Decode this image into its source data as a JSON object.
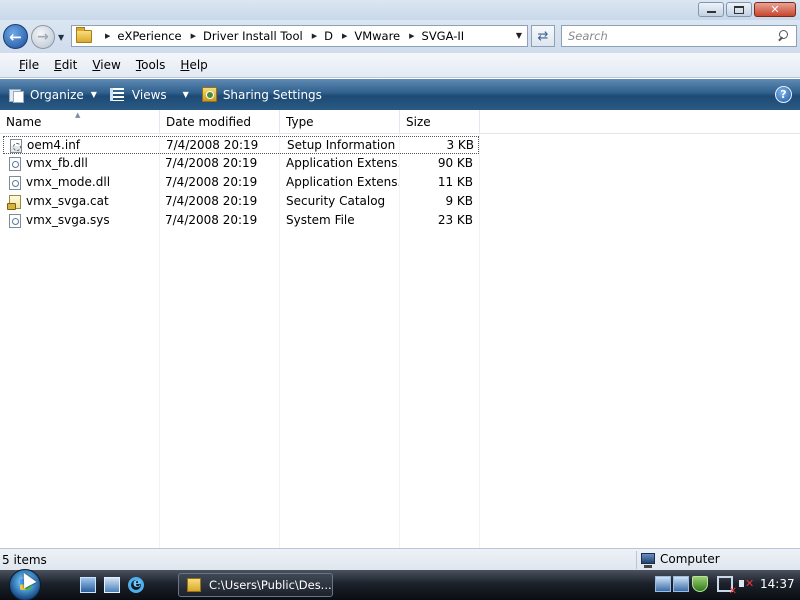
{
  "window": {
    "minimize_label": "",
    "maximize_label": "",
    "close_label": "✕"
  },
  "address": {
    "crumbs": [
      "eXPerience",
      "Driver Install Tool",
      "D",
      "VMware",
      "SVGA-II"
    ]
  },
  "search": {
    "placeholder": "Search"
  },
  "menu": {
    "items": [
      "File",
      "Edit",
      "View",
      "Tools",
      "Help"
    ]
  },
  "commands": {
    "organize": "Organize",
    "views": "Views",
    "sharing": "Sharing Settings",
    "help_glyph": "?"
  },
  "columns": [
    "Name",
    "Date modified",
    "Type",
    "Size"
  ],
  "files": [
    {
      "name": "oem4.inf",
      "date": "7/4/2008 20:19",
      "type": "Setup Information",
      "size": "3 KB",
      "icon": "inf-file-icon"
    },
    {
      "name": "vmx_fb.dll",
      "date": "7/4/2008 20:19",
      "type": "Application Extens...",
      "size": "90 KB",
      "icon": "dll-file-icon"
    },
    {
      "name": "vmx_mode.dll",
      "date": "7/4/2008 20:19",
      "type": "Application Extens...",
      "size": "11 KB",
      "icon": "dll-file-icon"
    },
    {
      "name": "vmx_svga.cat",
      "date": "7/4/2008 20:19",
      "type": "Security Catalog",
      "size": "9 KB",
      "icon": "catalog-file-icon"
    },
    {
      "name": "vmx_svga.sys",
      "date": "7/4/2008 20:19",
      "type": "System File",
      "size": "23 KB",
      "icon": "sys-file-icon"
    }
  ],
  "status": {
    "items": "5 items",
    "location": "Computer"
  },
  "taskbar": {
    "task_label": "C:\\Users\\Public\\Des...",
    "clock": "14:37"
  },
  "colors": {
    "command_bar": "#2f5f8d",
    "taskbar": "#1c222b",
    "accent": "#1a4f9c"
  }
}
